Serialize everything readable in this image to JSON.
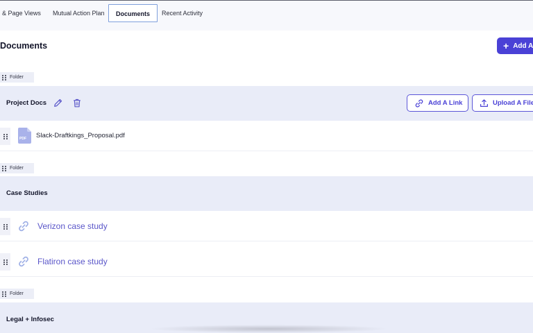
{
  "tabs": [
    {
      "label": "& Page Views",
      "active": false
    },
    {
      "label": "Mutual Action Plan",
      "active": false
    },
    {
      "label": "Documents",
      "active": true
    },
    {
      "label": "Recent Activity",
      "active": false
    }
  ],
  "page": {
    "title": "Documents",
    "add_button_label": "Add A"
  },
  "folder_tag_label": "Folder",
  "folders": [
    {
      "name": "Project Docs",
      "add_link_label": "Add A Link",
      "upload_label": "Upload A File"
    },
    {
      "name": "Case Studies"
    },
    {
      "name": "Legal + Infosec"
    }
  ],
  "items": {
    "pdf_file": "Slack-Draftkings_Proposal.pdf",
    "pdf_badge": "PDF",
    "link_1": "Verizon case study",
    "link_2": "Flatiron case study"
  },
  "colors": {
    "accent": "#4a41d6",
    "folder_bg": "#e9ecf8",
    "link_text": "#5a56c9"
  },
  "icons": [
    "pencil-icon",
    "trash-icon",
    "link-icon",
    "upload-icon",
    "pdf-file-icon",
    "drag-handle-icon",
    "plus-icon"
  ]
}
